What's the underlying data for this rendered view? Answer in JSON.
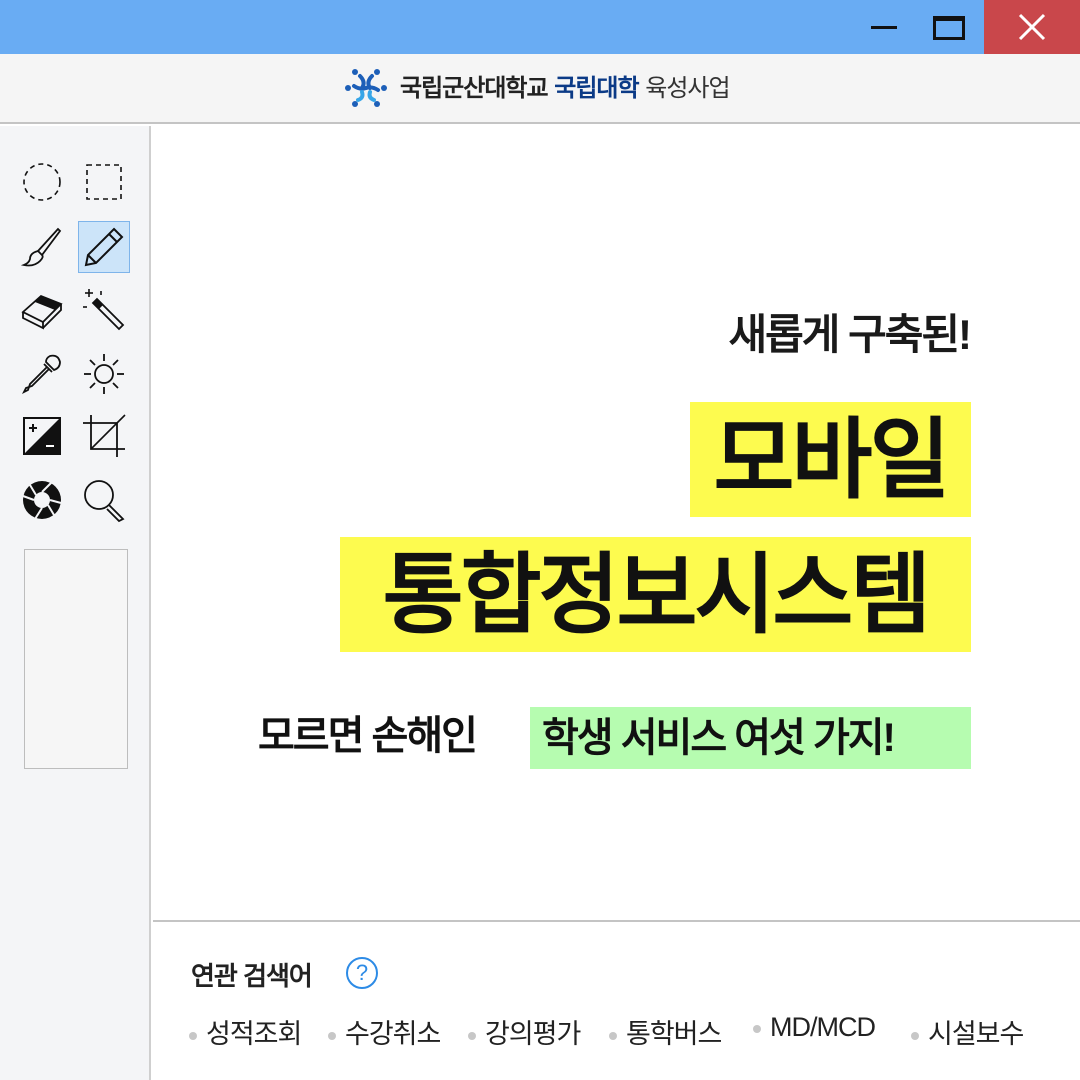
{
  "window": {
    "controls": [
      "minimize",
      "maximize",
      "close"
    ]
  },
  "header": {
    "brand_part1": "국립군산대학교",
    "brand_part2": "국립대학",
    "brand_part3": "육성사업",
    "brand_color": "#0b3a86"
  },
  "toolbox": {
    "tools": [
      "ellipse-select",
      "rect-select",
      "brush",
      "pencil",
      "eraser",
      "magic-wand",
      "eyedropper",
      "brightness",
      "exposure",
      "crop",
      "aperture",
      "zoom"
    ],
    "active_tool": "pencil"
  },
  "canvas": {
    "line1": "새롭게 구축된!",
    "highlight1": "모바일",
    "highlight2": "통합정보시스템",
    "line4_plain": "모르면 손해인",
    "line4_highlight": "학생 서비스 여섯 가지!",
    "highlight_yellow": "#fdfb4f",
    "highlight_green": "#b6fcb0"
  },
  "related": {
    "title": "연관 검색어",
    "help_label": "?",
    "keywords": [
      "성적조회",
      "수강취소",
      "강의평가",
      "통학버스",
      "MD/MCD",
      "시설보수"
    ]
  }
}
